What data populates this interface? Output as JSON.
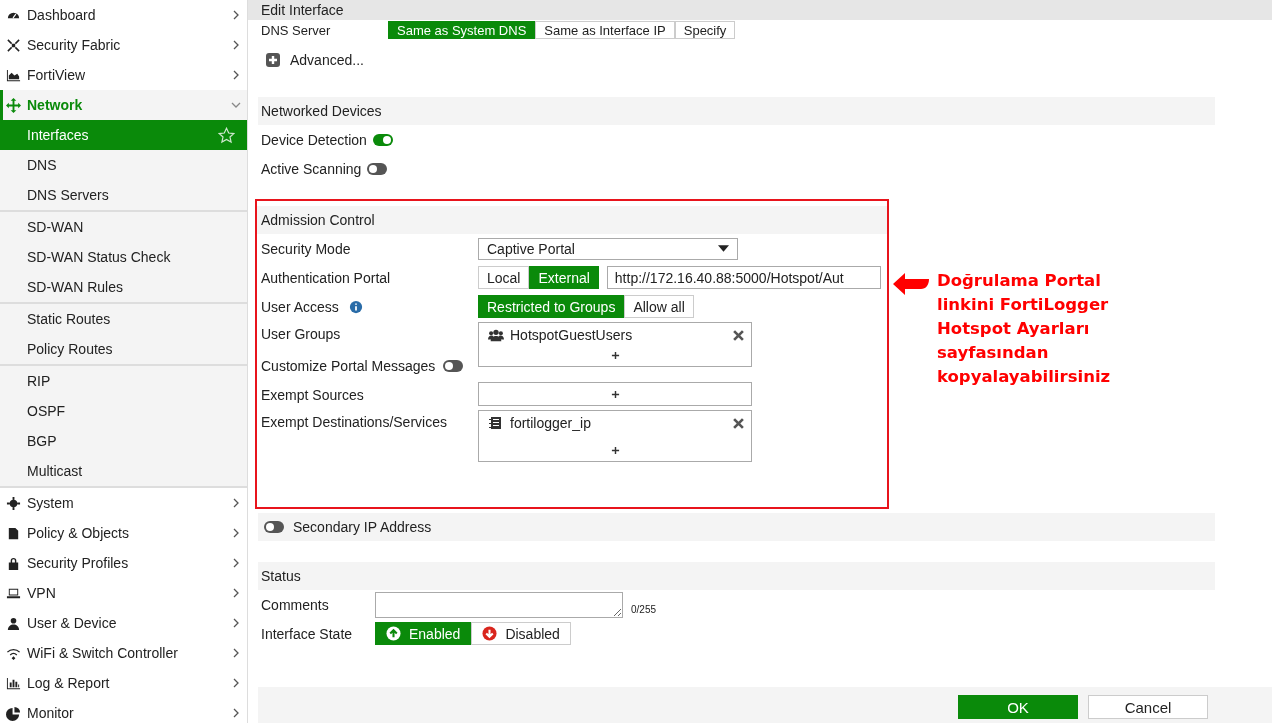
{
  "sidebar": {
    "items": [
      {
        "label": "Dashboard",
        "expanded": false
      },
      {
        "label": "Security Fabric",
        "expanded": false
      },
      {
        "label": "FortiView",
        "expanded": false
      },
      {
        "label": "Network",
        "expanded": true,
        "child_groups": [
          {
            "items": [
              {
                "label": "Interfaces",
                "selected": true,
                "favorite": false
              },
              {
                "label": "DNS",
                "selected": false
              },
              {
                "label": "DNS Servers",
                "selected": false
              }
            ]
          },
          {
            "items": [
              {
                "label": "SD-WAN",
                "selected": false
              },
              {
                "label": "SD-WAN Status Check",
                "selected": false
              },
              {
                "label": "SD-WAN Rules",
                "selected": false
              }
            ]
          },
          {
            "items": [
              {
                "label": "Static Routes",
                "selected": false
              },
              {
                "label": "Policy Routes",
                "selected": false
              }
            ]
          },
          {
            "items": [
              {
                "label": "RIP",
                "selected": false
              },
              {
                "label": "OSPF",
                "selected": false
              },
              {
                "label": "BGP",
                "selected": false
              },
              {
                "label": "Multicast",
                "selected": false
              }
            ]
          }
        ]
      },
      {
        "label": "System",
        "expanded": false
      },
      {
        "label": "Policy & Objects",
        "expanded": false
      },
      {
        "label": "Security Profiles",
        "expanded": false
      },
      {
        "label": "VPN",
        "expanded": false
      },
      {
        "label": "User & Device",
        "expanded": false
      },
      {
        "label": "WiFi & Switch Controller",
        "expanded": false
      },
      {
        "label": "Log & Report",
        "expanded": false
      },
      {
        "label": "Monitor",
        "expanded": false
      }
    ]
  },
  "header": {
    "title": "Edit Interface"
  },
  "dns_server": {
    "label": "DNS Server",
    "options": [
      {
        "label": "Same as System DNS",
        "selected": true
      },
      {
        "label": "Same as Interface IP",
        "selected": false
      },
      {
        "label": "Specify",
        "selected": false
      }
    ]
  },
  "advanced": {
    "label": "Advanced..."
  },
  "networked_devices": {
    "title": "Networked Devices",
    "toggles": [
      {
        "label": "Device Detection",
        "on": true
      },
      {
        "label": "Active Scanning",
        "on": false
      }
    ]
  },
  "admission_control": {
    "title": "Admission Control",
    "security_mode": {
      "label": "Security Mode",
      "value": "Captive Portal"
    },
    "authentication_portal": {
      "label": "Authentication Portal",
      "options": [
        {
          "label": "Local",
          "selected": false
        },
        {
          "label": "External",
          "selected": true
        }
      ],
      "url": "http://172.16.40.88:5000/Hotspot/Aut"
    },
    "user_access": {
      "label": "User Access",
      "options": [
        {
          "label": "Restricted to Groups",
          "selected": true
        },
        {
          "label": "Allow all",
          "selected": false
        }
      ]
    },
    "user_groups": {
      "label": "User Groups",
      "entries": [
        "HotspotGuestUsers"
      ]
    },
    "customize_portal_messages": {
      "label": "Customize Portal Messages",
      "on": false
    },
    "exempt_sources": {
      "label": "Exempt Sources"
    },
    "exempt_destinations": {
      "label": "Exempt Destinations/Services",
      "entries": [
        "fortilogger_ip"
      ]
    }
  },
  "annotation": {
    "lines": [
      "Doğrulama Portal",
      "linkini FortiLogger",
      "Hotspot Ayarları",
      "sayfasından",
      "kopyalayabilirsiniz"
    ]
  },
  "secondary_ip": {
    "label": "Secondary IP Address",
    "on": false
  },
  "status": {
    "title": "Status",
    "comments": {
      "label": "Comments",
      "counter": "0/255"
    },
    "interface_state": {
      "label": "Interface State",
      "options": [
        {
          "label": "Enabled",
          "selected": true,
          "kind": "up"
        },
        {
          "label": "Disabled",
          "selected": false,
          "kind": "down"
        }
      ]
    }
  },
  "buttons": [
    {
      "label": "OK",
      "kind": "primary"
    },
    {
      "label": "Cancel",
      "kind": "secondary"
    }
  ]
}
